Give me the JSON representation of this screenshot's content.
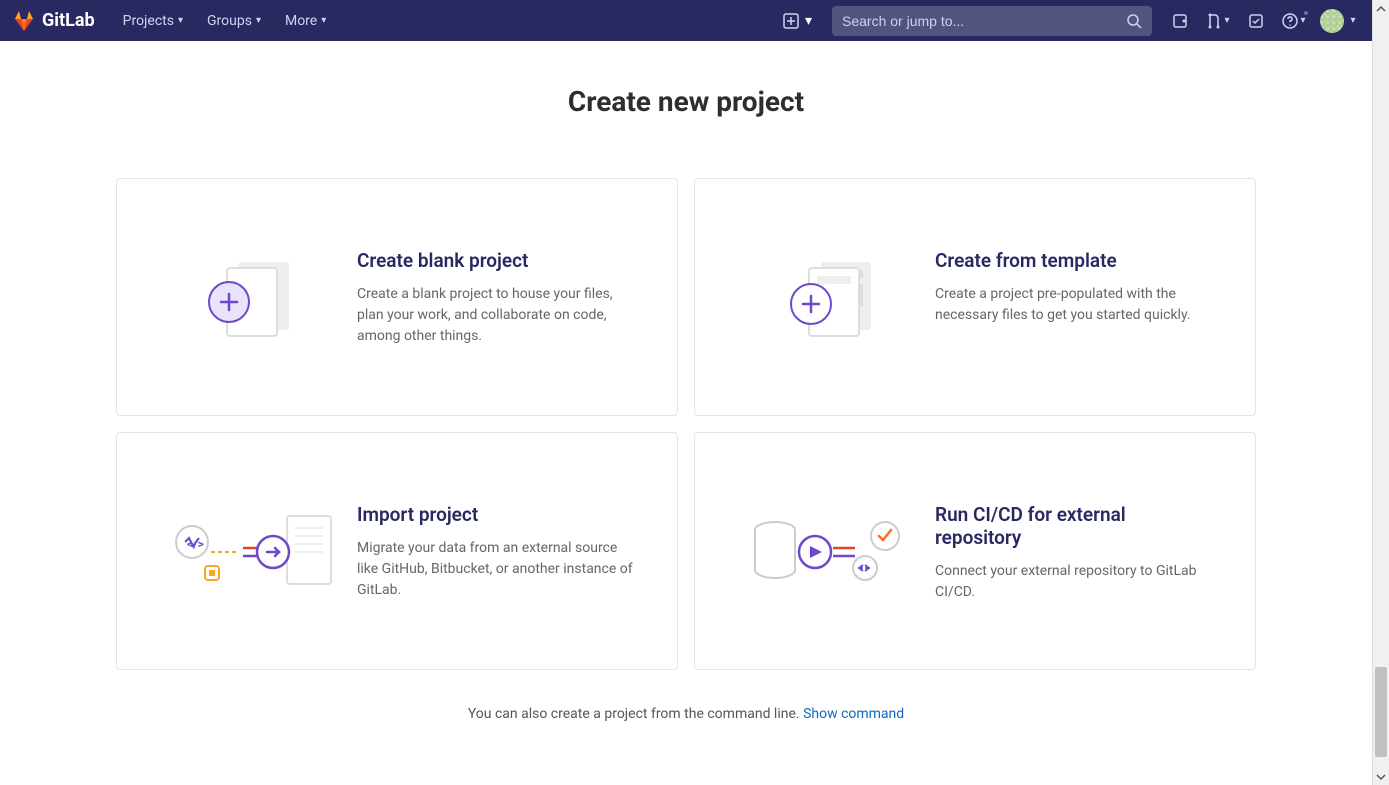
{
  "brand": "GitLab",
  "nav": {
    "projects": "Projects",
    "groups": "Groups",
    "more": "More"
  },
  "search": {
    "placeholder": "Search or jump to..."
  },
  "page": {
    "title": "Create new project"
  },
  "cards": {
    "blank": {
      "title": "Create blank project",
      "desc": "Create a blank project to house your files, plan your work, and collaborate on code, among other things."
    },
    "template": {
      "title": "Create from template",
      "desc": "Create a project pre-populated with the necessary files to get you started quickly."
    },
    "import": {
      "title": "Import project",
      "desc": "Migrate your data from an external source like GitHub, Bitbucket, or another instance of GitLab."
    },
    "cicd": {
      "title": "Run CI/CD for external repository",
      "desc": "Connect your external repository to GitLab CI/CD."
    }
  },
  "cli": {
    "text": "You can also create a project from the command line. ",
    "link": "Show command"
  }
}
